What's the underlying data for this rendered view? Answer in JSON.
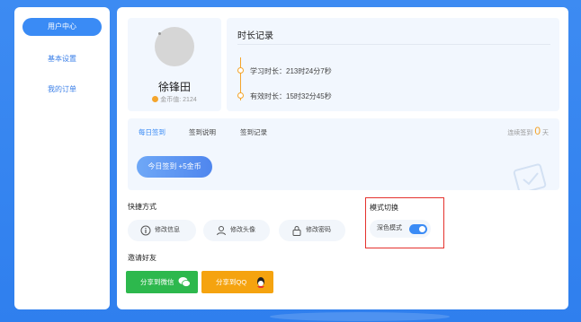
{
  "sidebar": {
    "items": [
      {
        "label": "用户中心",
        "active": true
      },
      {
        "label": "基本设置",
        "active": false
      },
      {
        "label": "我的订单",
        "active": false
      }
    ]
  },
  "profile": {
    "name": "徐锋田",
    "coin_label": "金币值:",
    "coin_value": "2124"
  },
  "time_record": {
    "title": "时长记录",
    "study": "学习时长：213时24分7秒",
    "effective": "有效时长：15时32分45秒"
  },
  "sign": {
    "tabs": [
      "每日签到",
      "签到说明",
      "签到记录"
    ],
    "streak_prefix": "连续签到",
    "streak_days": "0",
    "streak_suffix": "天",
    "button": "今日签到 +5金币"
  },
  "quick": {
    "title": "快捷方式",
    "buttons": [
      "修改信息",
      "修改头像",
      "修改密码"
    ]
  },
  "mode": {
    "title": "模式切换",
    "label": "深色模式",
    "enabled": true
  },
  "invite": {
    "title": "邀请好友",
    "wechat": "分享到微信",
    "qq": "分享到QQ"
  },
  "colors": {
    "accent": "#3a8bf5",
    "orange": "#f4a52c",
    "wechat": "#2db84d",
    "qq": "#f5a30f",
    "highlight": "#e5322d"
  }
}
